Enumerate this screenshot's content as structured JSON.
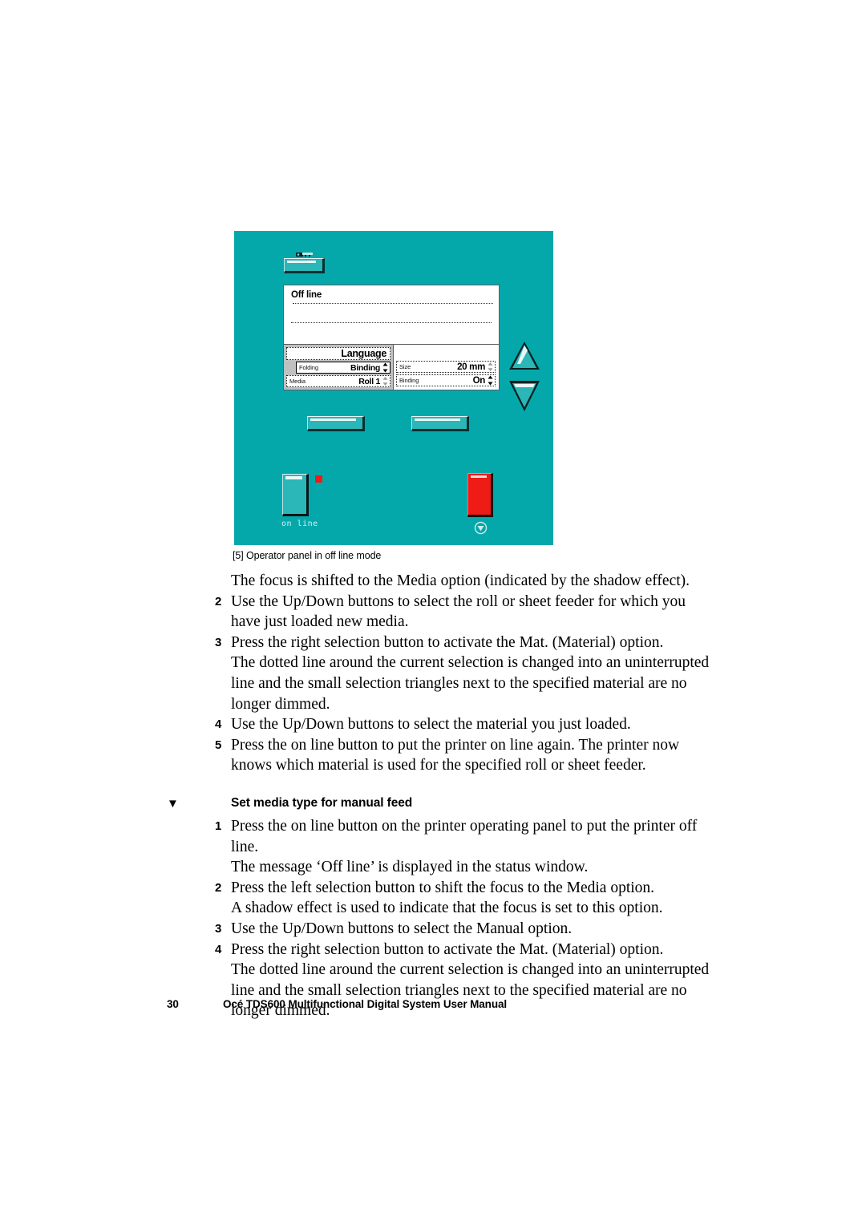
{
  "figure": {
    "panel_background": "#04a8ab",
    "key_icon": "key-icon",
    "menu_button_label": "",
    "status_window": {
      "message": "Off line"
    },
    "settings_left": [
      {
        "label": "",
        "value": "Language",
        "type": "header",
        "border": "dotted",
        "spinner": false
      },
      {
        "label": "Folding",
        "value": "Binding",
        "type": "row",
        "border": "solid",
        "spinner": true,
        "spinner_state": "active"
      },
      {
        "label": "Media",
        "value": "Roll 1",
        "type": "row",
        "border": "dotted",
        "spinner": true,
        "spinner_state": "dimmed"
      }
    ],
    "settings_right": [
      {
        "label": "",
        "value": "",
        "type": "blank",
        "border": "none",
        "spinner": false
      },
      {
        "label": "Size",
        "value": "20 mm",
        "type": "row",
        "border": "dotted",
        "spinner": true,
        "spinner_state": "dimmed"
      },
      {
        "label": "Binding",
        "value": "On",
        "type": "row",
        "border": "dotted",
        "spinner": true,
        "spinner_state": "active"
      }
    ],
    "up_arrow_icon": "triangle-up-icon",
    "down_arrow_icon": "triangle-down-icon",
    "left_selection_button_label": "",
    "right_selection_button_label": "",
    "online_button_label": "on line",
    "online_led_color": "#ef1c15",
    "stop_button_color": "#ee1b16",
    "stop_icon": "stop-icon",
    "caption": "[5] Operator panel in off line mode"
  },
  "body": {
    "intro": "The focus is shifted to the Media option (indicated by the shadow effect).",
    "steps_a": [
      {
        "num": "2",
        "text": "Use the Up/Down buttons to select the roll or sheet feeder for which you have just loaded new media."
      },
      {
        "num": "3",
        "text": "Press the right selection button to activate the Mat. (Material) option."
      },
      {
        "num": "",
        "text": "The dotted line around the current selection is changed into an uninterrupted line and the small selection triangles next to the specified material are no longer dimmed."
      },
      {
        "num": "4",
        "text": "Use the Up/Down buttons to select the material you just loaded."
      },
      {
        "num": "5",
        "text": "Press the on line button to put the printer on line again. The printer now knows which material is used for the specified roll or sheet feeder."
      }
    ],
    "section_bullet": "▼",
    "section_title": "Set media type for manual feed",
    "steps_b": [
      {
        "num": "1",
        "text": "Press the on line button on the printer operating panel to put the printer off line."
      },
      {
        "num": "",
        "text": "The message ‘Off line’ is displayed in the status window."
      },
      {
        "num": "2",
        "text": "Press the left selection button to shift the focus to the Media option."
      },
      {
        "num": "",
        "text": "A shadow effect is used to indicate that the focus is set to this option."
      },
      {
        "num": "3",
        "text": "Use the Up/Down buttons to select the Manual option."
      },
      {
        "num": "4",
        "text": "Press the right selection button to activate the Mat. (Material) option."
      },
      {
        "num": "",
        "text": "The dotted line around the current selection is changed into an uninterrupted line and the small selection triangles next to the specified material are no longer dimmed."
      }
    ]
  },
  "footer": {
    "page_number": "30",
    "title": "Océ TDS600 Multifunctional Digital System User Manual"
  }
}
